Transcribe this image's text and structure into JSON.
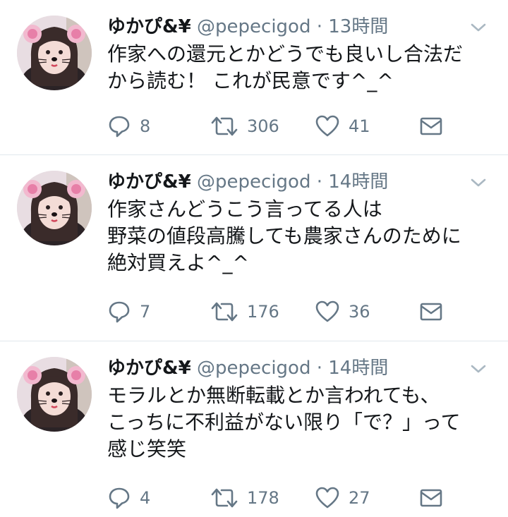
{
  "colors": {
    "text": "#14171a",
    "secondary": "#657786",
    "divider": "#e1e8ed"
  },
  "icons": {
    "reply": "reply-icon",
    "retweet": "retweet-icon",
    "like": "heart-icon",
    "dm": "envelope-icon",
    "more": "chevron-down-icon"
  },
  "tweets": [
    {
      "name": "ゆかぴ&¥",
      "handle": "@pepecigod",
      "sep": "·",
      "time": "13時間",
      "lines": [
        "作家への還元とかどうでも良いし合法だ",
        "から読む！ これが民意です^_^"
      ],
      "replies": "8",
      "retweets": "306",
      "likes": "41"
    },
    {
      "name": "ゆかぴ&¥",
      "handle": "@pepecigod",
      "sep": "·",
      "time": "14時間",
      "lines": [
        "作家さんどうこう言ってる人は",
        "野菜の値段高騰しても農家さんのために",
        "絶対買えよ^_^"
      ],
      "replies": "7",
      "retweets": "176",
      "likes": "36"
    },
    {
      "name": "ゆかぴ&¥",
      "handle": "@pepecigod",
      "sep": "·",
      "time": "14時間",
      "lines": [
        "モラルとか無断転載とか言われても、",
        "こっちに不利益がない限り「で？」って",
        "感じ笑笑"
      ],
      "replies": "4",
      "retweets": "178",
      "likes": "27"
    }
  ]
}
